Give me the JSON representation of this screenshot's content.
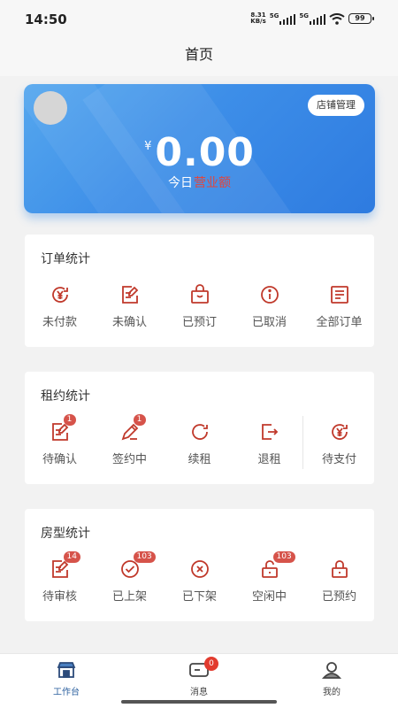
{
  "status_bar": {
    "time": "14:50",
    "net_speed": "8.31",
    "net_unit": "KB/s",
    "sim1": "5G",
    "sim2": "5G",
    "battery": "99"
  },
  "header": {
    "title": "首页"
  },
  "hero": {
    "shop_button": "店铺管理",
    "currency": "¥",
    "amount": "0.00",
    "caption": "今日营业额",
    "caption_highlight": "营业额"
  },
  "order_stats": {
    "title": "订单统计",
    "items": [
      {
        "label": "未付款",
        "icon": "yen-refresh-icon"
      },
      {
        "label": "未确认",
        "icon": "edit-doc-icon"
      },
      {
        "label": "已预订",
        "icon": "bag-icon"
      },
      {
        "label": "已取消",
        "icon": "info-circle-icon"
      },
      {
        "label": "全部订单",
        "icon": "list-doc-icon"
      }
    ]
  },
  "lease_stats": {
    "title": "租约统计",
    "items": [
      {
        "label": "待确认",
        "icon": "edit-doc-icon",
        "badge": "1"
      },
      {
        "label": "签约中",
        "icon": "pencil-icon",
        "badge": "1"
      },
      {
        "label": "续租",
        "icon": "refresh-icon",
        "badge": ""
      },
      {
        "label": "退租",
        "icon": "exit-icon",
        "badge": ""
      },
      {
        "label": "待支付",
        "icon": "yen-refresh-icon",
        "badge": ""
      }
    ]
  },
  "room_stats": {
    "title": "房型统计",
    "items": [
      {
        "label": "待审核",
        "icon": "edit-doc-icon",
        "badge": "14"
      },
      {
        "label": "已上架",
        "icon": "check-circle-icon",
        "badge": "103"
      },
      {
        "label": "已下架",
        "icon": "x-circle-icon",
        "badge": ""
      },
      {
        "label": "空闲中",
        "icon": "unlock-icon",
        "badge": "103"
      },
      {
        "label": "已预约",
        "icon": "lock-icon",
        "badge": ""
      }
    ]
  },
  "tabbar": {
    "items": [
      {
        "label": "工作台",
        "icon": "store-icon"
      },
      {
        "label": "消息",
        "icon": "message-icon",
        "badge": "0"
      },
      {
        "label": "我的",
        "icon": "user-icon"
      }
    ]
  },
  "colors": {
    "accent": "#3d8ee8",
    "icon": "#c0392b",
    "badge": "#d6534a",
    "tab_active": "#2b5f9e"
  }
}
